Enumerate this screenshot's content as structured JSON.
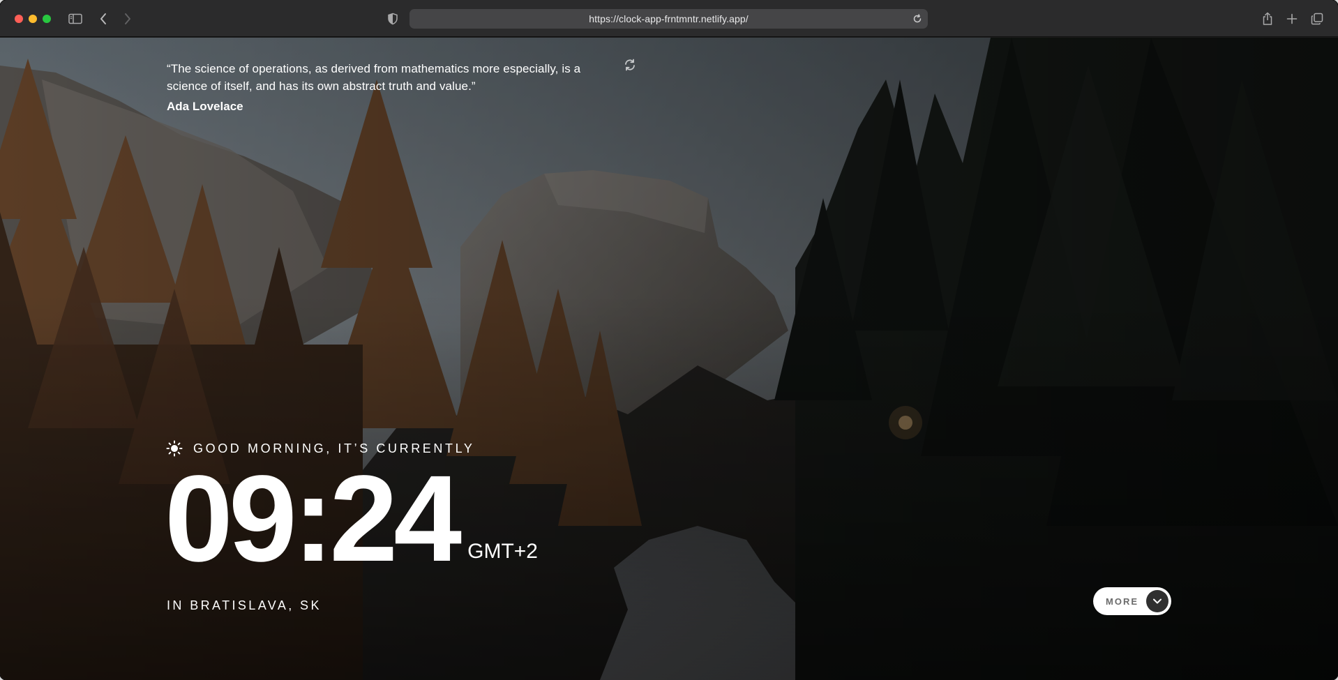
{
  "browser": {
    "url": "https://clock-app-frntmntr.netlify.app/",
    "icons": {
      "sidebar": "sidebar-icon",
      "back": "chevron-left-icon",
      "forward": "chevron-right-icon",
      "privacy": "shield-icon",
      "reload": "reload-icon",
      "share": "share-icon",
      "new_tab": "plus-icon",
      "tabs": "tabs-overview-icon"
    }
  },
  "quote": {
    "text": "“The science of operations, as derived from mathematics more especially, is a science of itself, and has its own abstract truth and value.”",
    "author": "Ada Lovelace",
    "refresh_icon": "refresh-icon"
  },
  "greeting": {
    "icon": "sun-icon",
    "text": "GOOD MORNING, IT’S CURRENTLY"
  },
  "clock": {
    "time": "09:24",
    "timezone": "GMT+2"
  },
  "location": {
    "text": "IN BRATISLAVA, SK"
  },
  "more_button": {
    "label": "MORE",
    "icon": "chevron-down-icon"
  },
  "colors": {
    "toolbar": "#2b2b2c",
    "urlbar": "#454547",
    "text": "#ffffff",
    "button_bg": "#ffffff",
    "button_circle": "#303030"
  }
}
